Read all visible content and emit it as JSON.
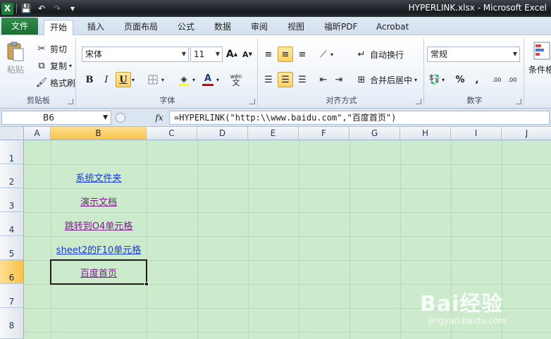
{
  "window": {
    "title": "HYPERLINK.xlsx - Microsoft Excel"
  },
  "qat": {
    "logo": "X",
    "save": "💾",
    "undo": "↶",
    "redo": "↷",
    "more": "▾"
  },
  "tabs": [
    "文件",
    "开始",
    "插入",
    "页面布局",
    "公式",
    "数据",
    "审阅",
    "视图",
    "福昕PDF",
    "Acrobat"
  ],
  "ribbon": {
    "clipboard": {
      "label": "剪贴板",
      "paste": "粘贴",
      "cut": "剪切",
      "copy": "复制",
      "format_painter": "格式刷"
    },
    "font": {
      "label": "字体",
      "font_name": "宋体",
      "font_size": "11",
      "grow": "A",
      "shrink": "A",
      "bold": "B",
      "italic": "I",
      "underline": "U",
      "font_color": "A",
      "wen": "wén"
    },
    "alignment": {
      "label": "对齐方式",
      "wrap": "自动换行",
      "merge": "合并后居中"
    },
    "number": {
      "label": "数字",
      "format": "常规",
      "percent": "%",
      "comma": ",",
      "inc_dec": ".00",
      "dec_dec": ".00"
    },
    "styles": {
      "conditional": "条件格"
    }
  },
  "formula_bar": {
    "name_box": "B6",
    "fx": "fx",
    "formula": "=HYPERLINK(\"http:\\\\www.baidu.com\",\"百度首页\")"
  },
  "columns": [
    "A",
    "B",
    "C",
    "D",
    "E",
    "F",
    "G",
    "H",
    "I",
    "J"
  ],
  "rows": [
    "1",
    "2",
    "3",
    "4",
    "5",
    "6",
    "7",
    "8"
  ],
  "cells": {
    "B2": "系统文件夹",
    "B3": "演示文档",
    "B4": "跳转到O4单元格",
    "B5": "sheet2的F10单元格",
    "B6": "百度首页"
  },
  "selected_cell": "B6",
  "watermark": {
    "text": "Bai经验",
    "sub": "jingyan.baidu.com"
  }
}
